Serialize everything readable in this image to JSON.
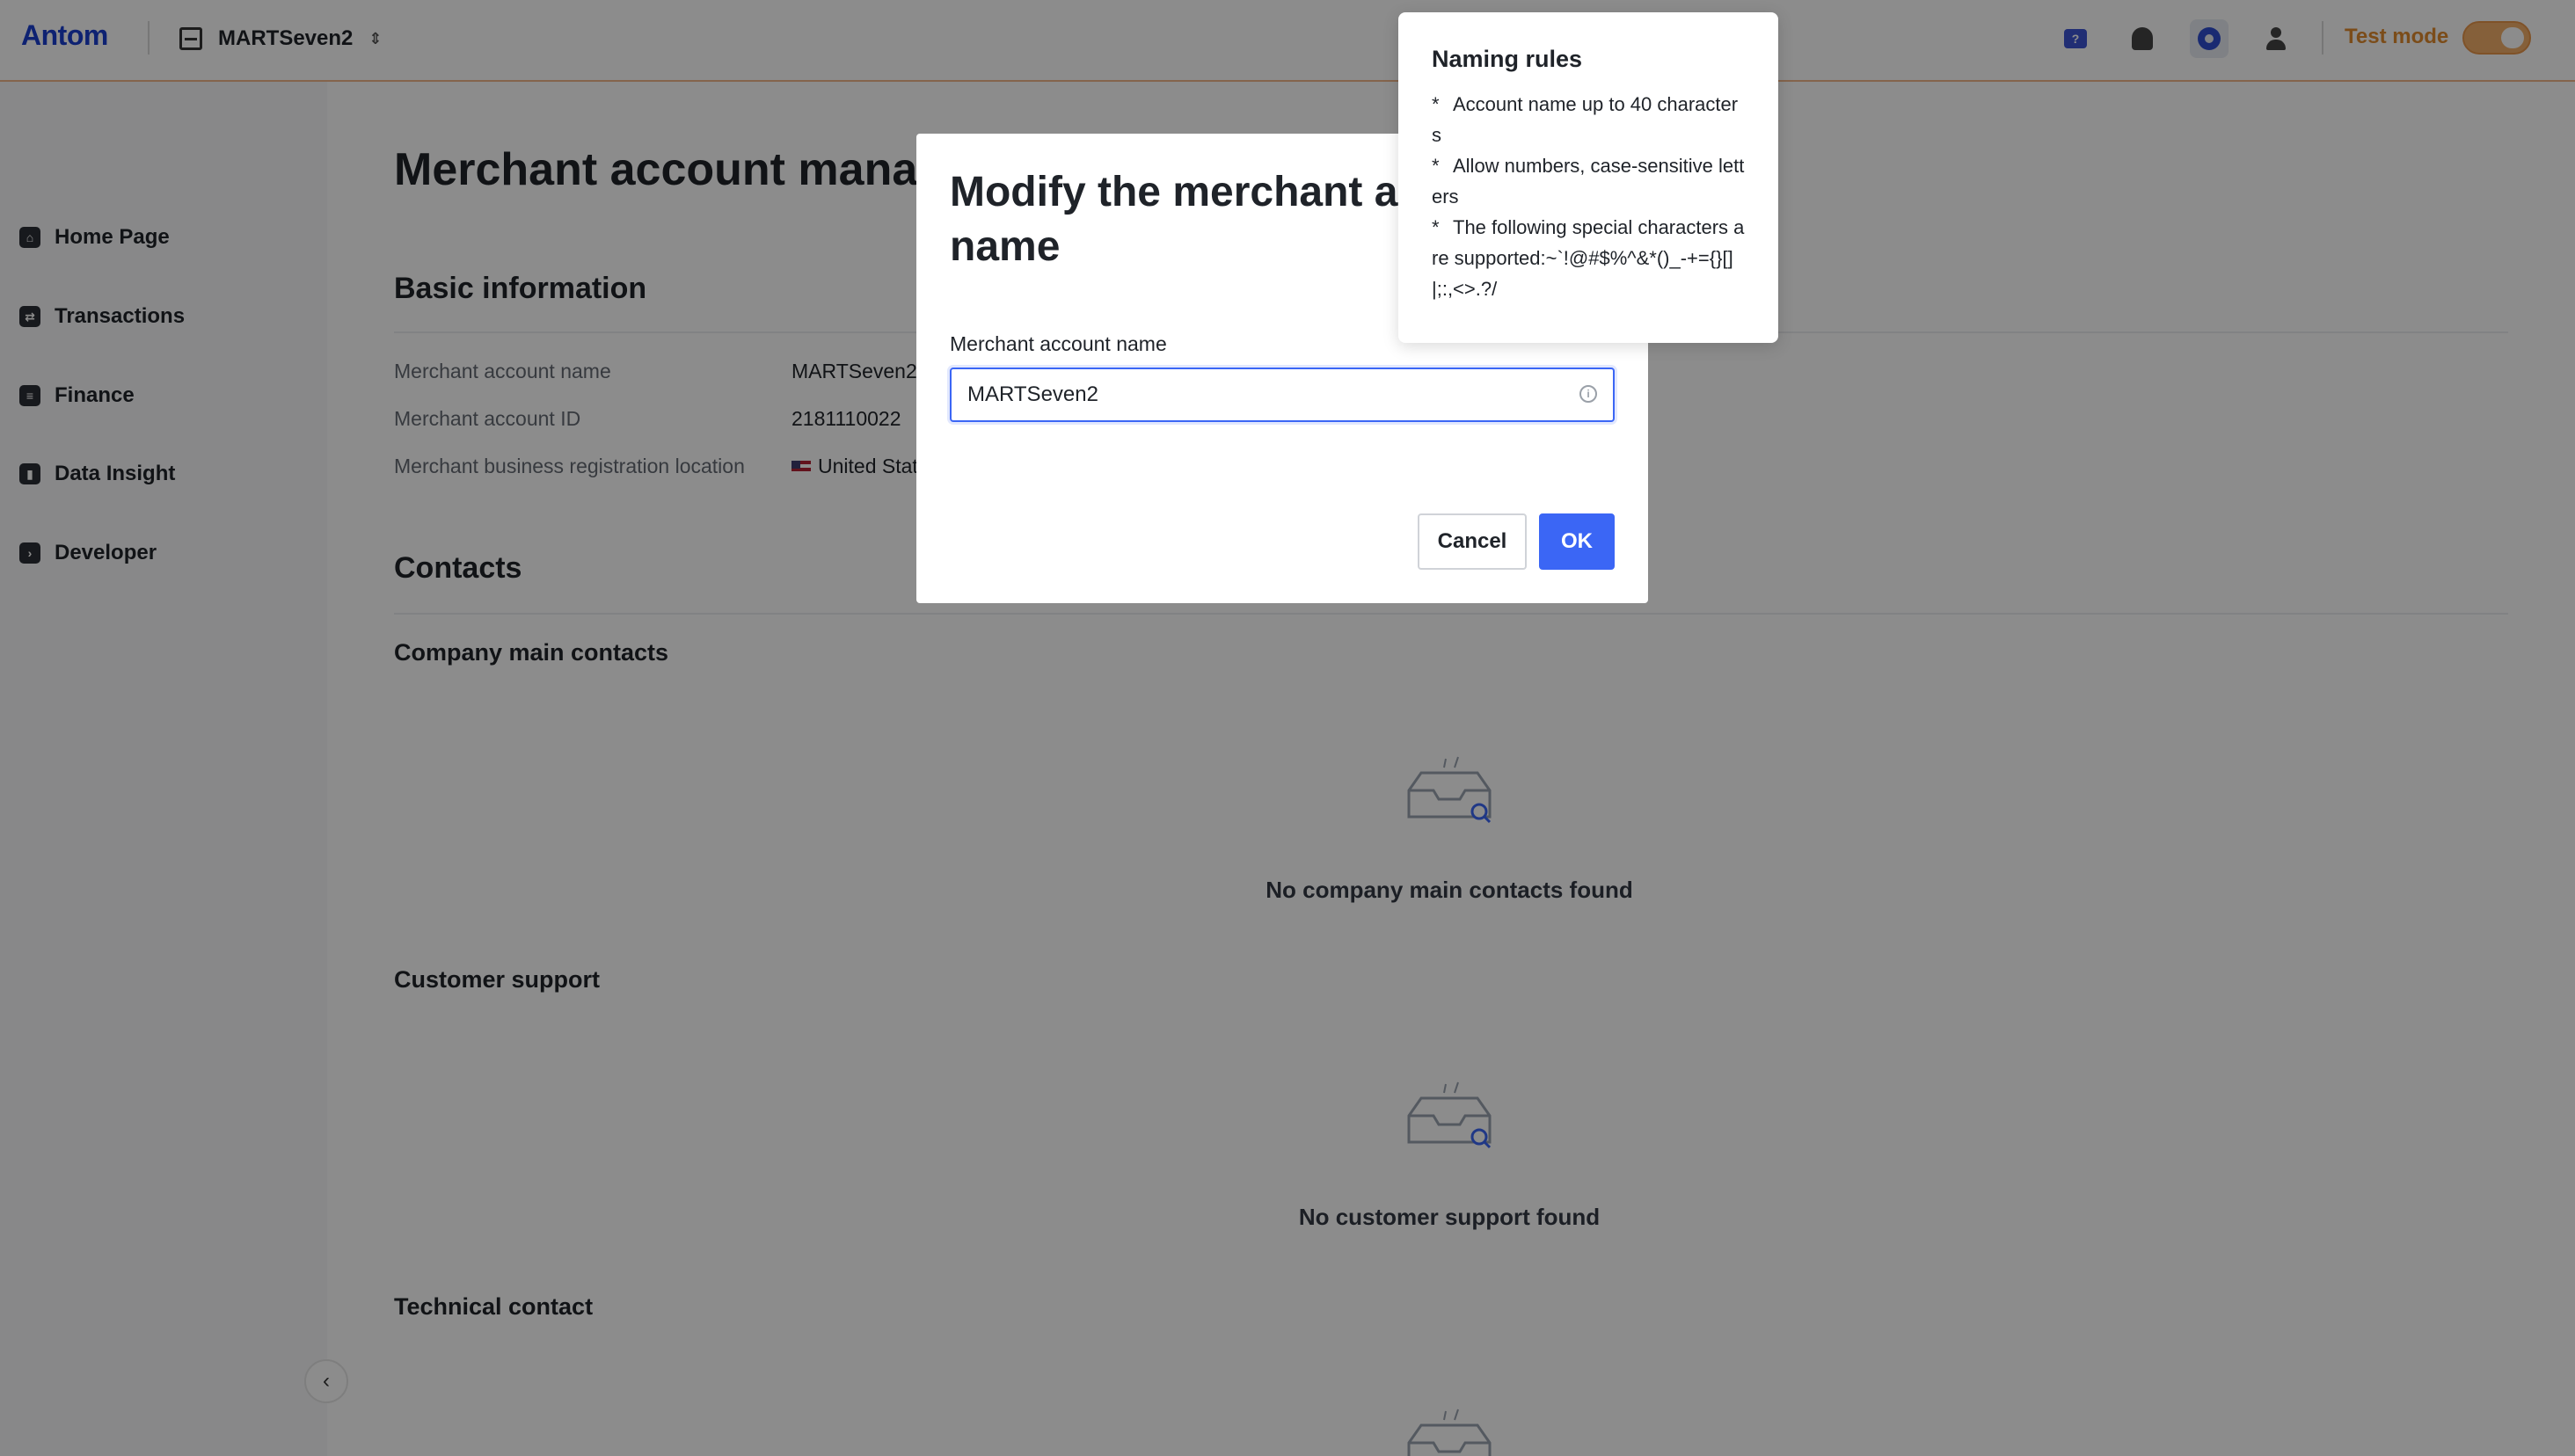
{
  "header": {
    "logo": "Antom",
    "account_name": "MARTSeven2",
    "test_mode_label": "Test mode",
    "icons": [
      "chat-help-icon",
      "bell-icon",
      "gear-icon",
      "user-icon"
    ],
    "chat_badge": "?"
  },
  "sidebar": {
    "items": [
      {
        "label": "Home Page",
        "icon": "home-icon"
      },
      {
        "label": "Transactions",
        "icon": "transactions-icon"
      },
      {
        "label": "Finance",
        "icon": "finance-icon"
      },
      {
        "label": "Data Insight",
        "icon": "chart-icon"
      },
      {
        "label": "Developer",
        "icon": "terminal-icon"
      }
    ]
  },
  "main": {
    "page_title": "Merchant account manag",
    "basic_info": {
      "title": "Basic information",
      "rows": [
        {
          "label": "Merchant account name",
          "value": "MARTSeven2"
        },
        {
          "label": "Merchant account ID",
          "value": "2181110022"
        },
        {
          "label": "Merchant business registration location",
          "value": "United Stat"
        }
      ]
    },
    "contacts": {
      "title": "Contacts",
      "groups": [
        {
          "title": "Company main contacts",
          "empty": "No company main contacts found"
        },
        {
          "title": "Customer support",
          "empty": "No customer support found"
        },
        {
          "title": "Technical contact",
          "empty": ""
        }
      ]
    }
  },
  "modal": {
    "title": "Modify the merchant ac name",
    "field_label": "Merchant account name",
    "field_value": "MARTSeven2",
    "cancel_label": "Cancel",
    "ok_label": "OK"
  },
  "tooltip": {
    "title": "Naming rules",
    "rules": [
      "Account name up to 40 characters",
      "Allow numbers, case-sensitive letters",
      "The following special characters are supported:~`!@#$%^&*()_-+={}[]|;:,<>.?/"
    ]
  },
  "colors": {
    "accent": "#3b66f5",
    "test_mode": "#e08a2e",
    "logo": "#1a3fd0"
  }
}
